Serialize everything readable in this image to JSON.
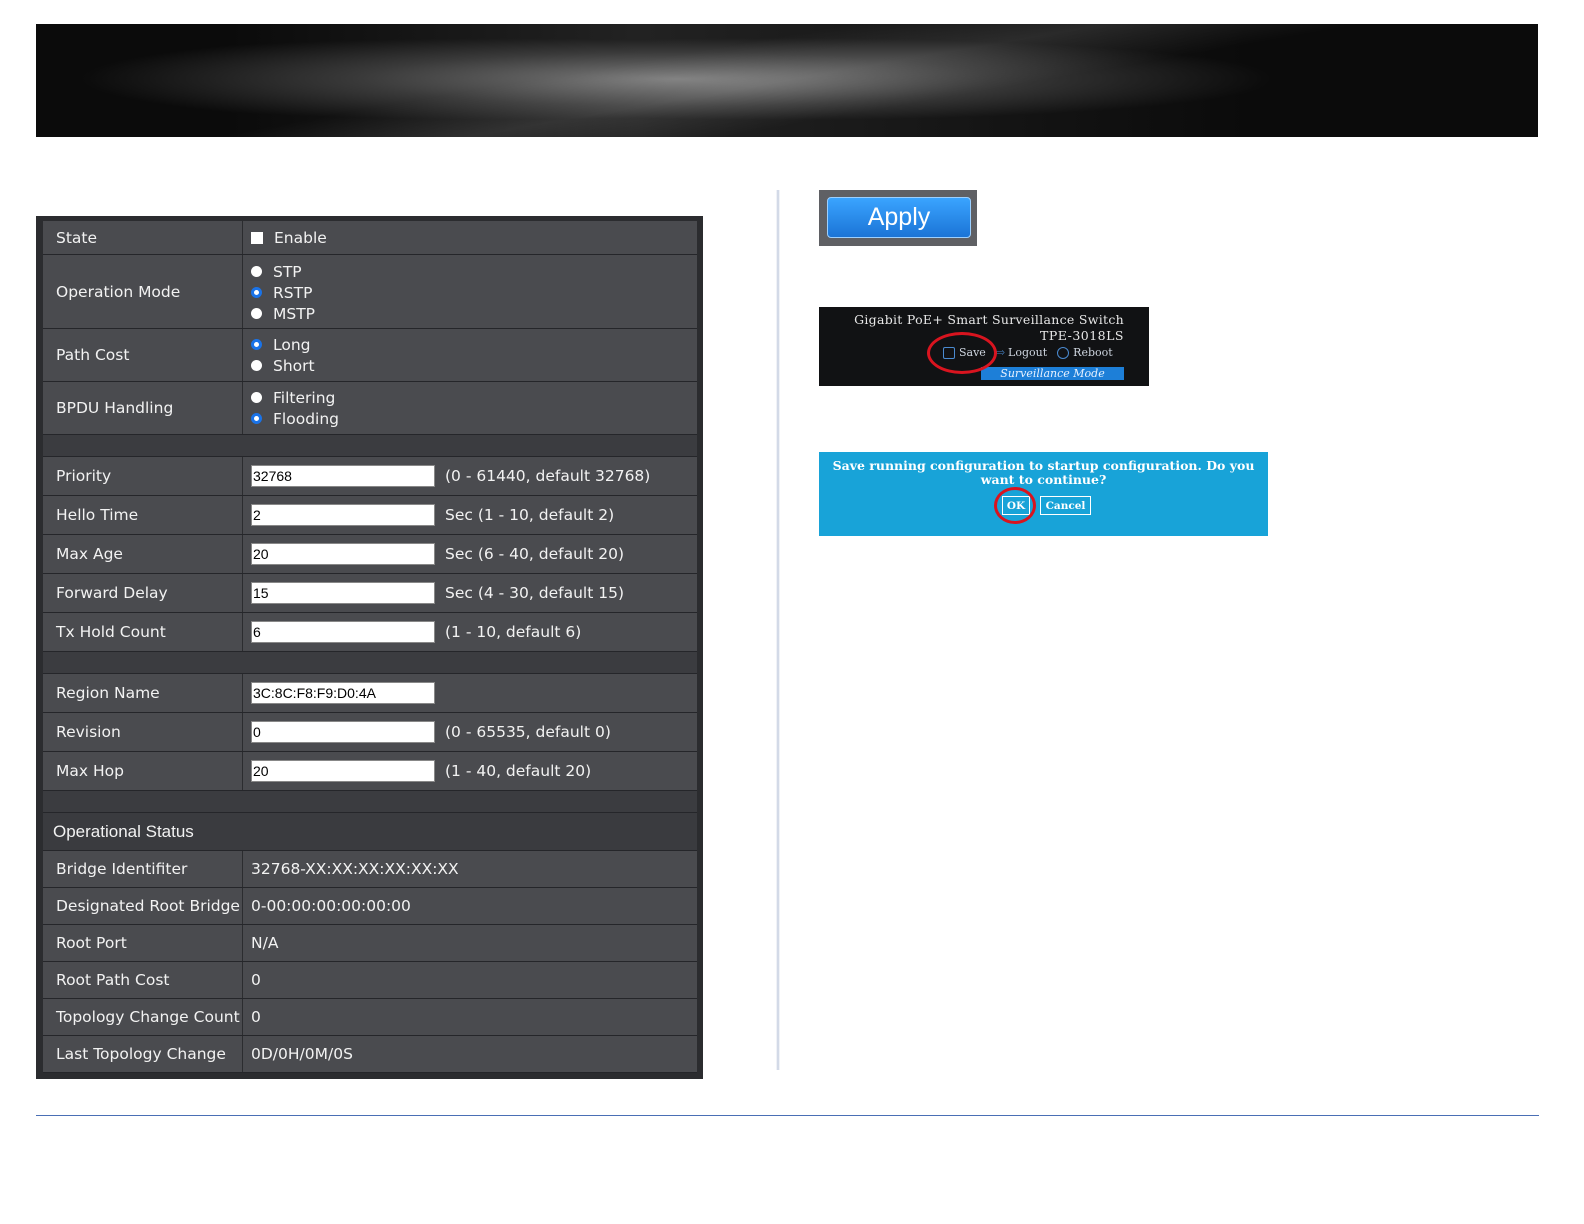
{
  "stp_form": {
    "state": {
      "label": "State",
      "option": "Enable",
      "checked": false
    },
    "operation_mode": {
      "label": "Operation Mode",
      "options": [
        "STP",
        "RSTP",
        "MSTP"
      ],
      "selected": "RSTP"
    },
    "path_cost": {
      "label": "Path Cost",
      "options": [
        "Long",
        "Short"
      ],
      "selected": "Long"
    },
    "bpdu_handling": {
      "label": "BPDU Handling",
      "options": [
        "Filtering",
        "Flooding"
      ],
      "selected": "Flooding"
    },
    "fields": [
      {
        "label": "Priority",
        "value": "32768",
        "hint": "(0 - 61440, default 32768)"
      },
      {
        "label": "Hello Time",
        "value": "2",
        "hint": "Sec (1 - 10, default 2)"
      },
      {
        "label": "Max Age",
        "value": "20",
        "hint": "Sec (6 - 40, default 20)"
      },
      {
        "label": "Forward Delay",
        "value": "15",
        "hint": "Sec (4 - 30, default 15)"
      },
      {
        "label": "Tx Hold Count",
        "value": "6",
        "hint": "(1 - 10, default 6)"
      }
    ],
    "mstp_fields": [
      {
        "label": "Region Name",
        "value": "3C:8C:F8:F9:D0:4A",
        "hint": ""
      },
      {
        "label": "Revision",
        "value": "0",
        "hint": "(0 - 65535, default 0)"
      },
      {
        "label": "Max Hop",
        "value": "20",
        "hint": "(1 - 40, default 20)"
      }
    ]
  },
  "operational_status": {
    "title": "Operational Status",
    "rows": [
      {
        "label": "Bridge Identifiter",
        "value": "32768-XX:XX:XX:XX:XX:XX"
      },
      {
        "label": "Designated Root Bridge",
        "value": "0-00:00:00:00:00:00"
      },
      {
        "label": "Root Port",
        "value": "N/A"
      },
      {
        "label": "Root Path Cost",
        "value": "0"
      },
      {
        "label": "Topology Change Count",
        "value": "0"
      },
      {
        "label": "Last Topology Change",
        "value": "0D/0H/0M/0S"
      }
    ]
  },
  "apply_button": {
    "label": "Apply"
  },
  "switch_header": {
    "title": "Gigabit PoE+ Smart Surveillance Switch",
    "model": "TPE-3018LS",
    "save": "Save",
    "logout": "Logout",
    "reboot": "Reboot",
    "mode": "Surveillance Mode"
  },
  "save_dialog": {
    "message": "Save running configuration to startup configuration. Do you want to continue?",
    "ok": "OK",
    "cancel": "Cancel"
  },
  "colors": {
    "highlight_circle": "#d9141f",
    "dialog_bg": "#18a3d8",
    "radio_selected": "#1a73e8"
  }
}
